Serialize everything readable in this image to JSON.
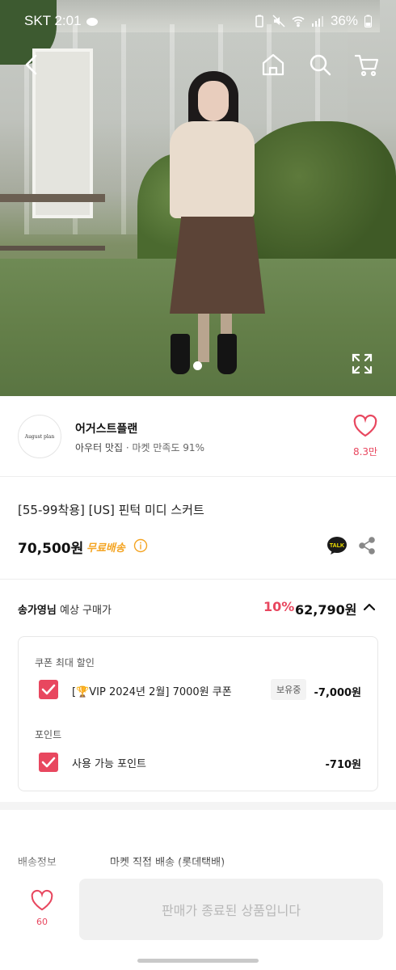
{
  "status_bar": {
    "time": "SKT 2:01",
    "battery": "36%",
    "icons": [
      "cloud-icon",
      "battery-saver-icon",
      "mute-icon",
      "wifi-icon",
      "signal-icon",
      "battery-icon"
    ]
  },
  "top_nav": {
    "icons": [
      "back-arrow-icon",
      "home-icon",
      "search-icon",
      "cart-icon"
    ]
  },
  "gallery": {
    "current_index": 1,
    "total": 1,
    "icons": [
      "fullscreen-icon"
    ]
  },
  "seller": {
    "logo_text": "August plan",
    "name": "어거스트플랜",
    "category": "아우터 맛집",
    "satisfaction": "· 마켓 만족도 91%",
    "like_count": "8.3만"
  },
  "product": {
    "title": "[55-99착용] [US] 핀턱 미디 스커트",
    "price": "70,500원",
    "shipping": "무료배송",
    "kakao_label": "TALK"
  },
  "expected_price": {
    "user_name": "송가영님",
    "label": "예상 구매가",
    "discount_pct": "10%",
    "price": "62,790원",
    "coupon_section": "쿠폰 최대 할인",
    "coupon_name": "[🏆VIP 2024년 2월] 7000원 쿠폰",
    "coupon_badge": "보유중",
    "coupon_amount": "-7,000원",
    "point_section": "포인트",
    "point_name": "사용 가능 포인트",
    "point_amount": "-710원"
  },
  "shipping_info": {
    "label": "배송정보",
    "value": "마켓 직접 배송 (롯데택배)"
  },
  "bottom_bar": {
    "like_count": "60",
    "cta_label": "판매가 종료된 상품입니다"
  },
  "colors": {
    "accent": "#e8475f",
    "free_shipping": "#f4a422",
    "disabled_button": "#f0f0f0"
  }
}
